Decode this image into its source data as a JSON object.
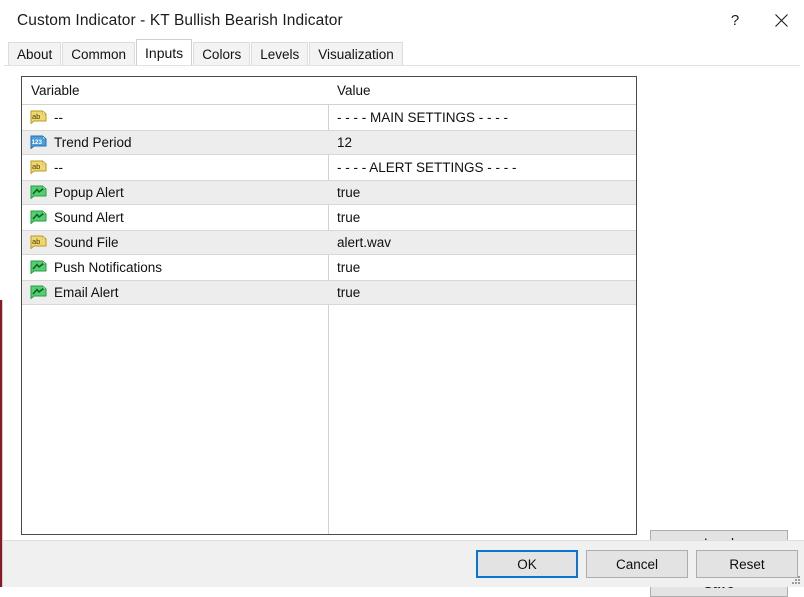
{
  "window": {
    "title": "Custom Indicator - KT Bullish Bearish Indicator",
    "help_label": "?",
    "close_label": "✕",
    "help_icon": "question-mark-icon",
    "close_icon": "close-x-icon"
  },
  "tabs": [
    {
      "label": "About",
      "active": false
    },
    {
      "label": "Common",
      "active": false
    },
    {
      "label": "Inputs",
      "active": true
    },
    {
      "label": "Colors",
      "active": false
    },
    {
      "label": "Levels",
      "active": false
    },
    {
      "label": "Visualization",
      "active": false
    }
  ],
  "table": {
    "headers": {
      "variable": "Variable",
      "value": "Value"
    },
    "rows": [
      {
        "icon": "string-tag-icon",
        "icon_type": "ab",
        "variable": "--",
        "value": "- - - - MAIN SETTINGS - - - -",
        "shaded": false
      },
      {
        "icon": "number-tag-icon",
        "icon_type": "123",
        "variable": "Trend Period",
        "value": "12",
        "shaded": true
      },
      {
        "icon": "string-tag-icon",
        "icon_type": "ab",
        "variable": "--",
        "value": "- - - - ALERT SETTINGS - - - -",
        "shaded": false
      },
      {
        "icon": "bool-tag-icon",
        "icon_type": "bool",
        "variable": "Popup Alert",
        "value": "true",
        "shaded": true
      },
      {
        "icon": "bool-tag-icon",
        "icon_type": "bool",
        "variable": "Sound Alert",
        "value": "true",
        "shaded": false
      },
      {
        "icon": "string-tag-icon",
        "icon_type": "ab",
        "variable": "Sound File",
        "value": "alert.wav",
        "shaded": true
      },
      {
        "icon": "bool-tag-icon",
        "icon_type": "bool",
        "variable": "Push Notifications",
        "value": "true",
        "shaded": false
      },
      {
        "icon": "bool-tag-icon",
        "icon_type": "bool",
        "variable": "Email Alert",
        "value": "true",
        "shaded": true
      }
    ]
  },
  "side_buttons": {
    "load": "Load",
    "save": "Save"
  },
  "footer_buttons": {
    "ok": "OK",
    "cancel": "Cancel",
    "reset": "Reset"
  },
  "colors": {
    "accent": "#0a74d4",
    "row_shaded": "#ededed",
    "icon_string": "#f0d870",
    "icon_number": "#4a9fe0",
    "icon_bool": "#52cf6e",
    "button_face": "#e3e3e3",
    "left_edge": "#8c1a22"
  }
}
